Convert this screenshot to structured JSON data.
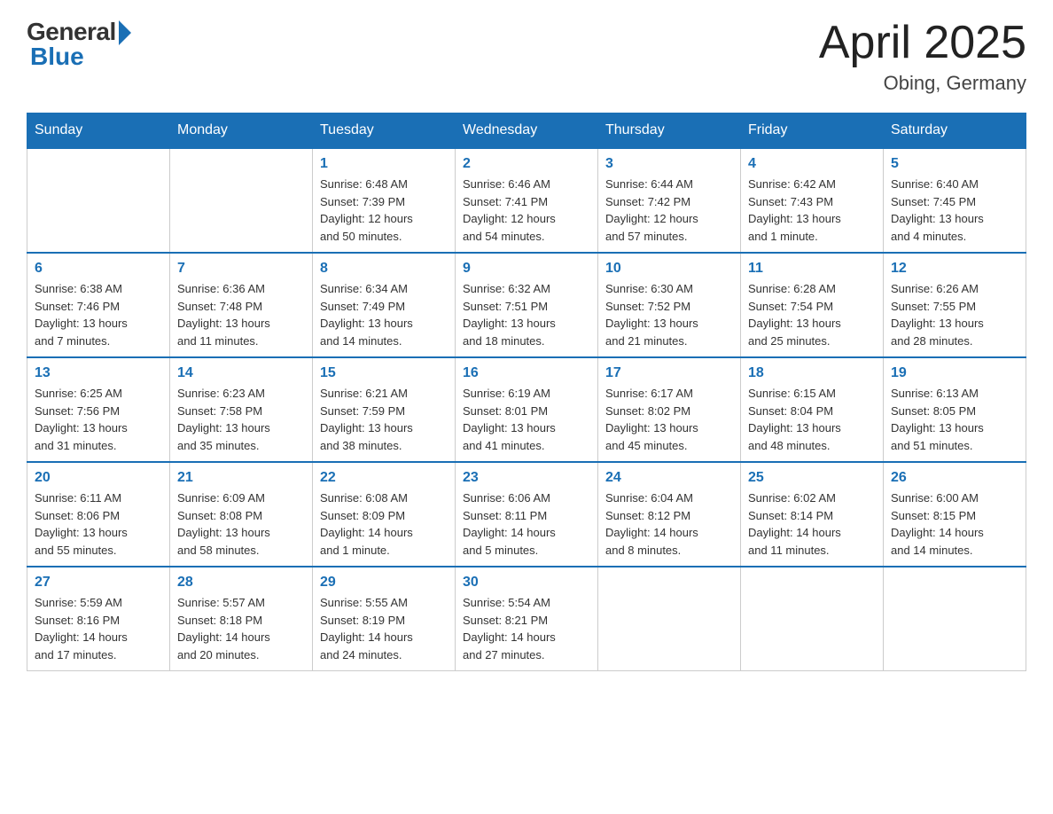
{
  "logo": {
    "general": "General",
    "blue": "Blue"
  },
  "title": {
    "month": "April 2025",
    "location": "Obing, Germany"
  },
  "weekdays": [
    "Sunday",
    "Monday",
    "Tuesday",
    "Wednesday",
    "Thursday",
    "Friday",
    "Saturday"
  ],
  "weeks": [
    [
      {
        "day": "",
        "info": ""
      },
      {
        "day": "",
        "info": ""
      },
      {
        "day": "1",
        "info": "Sunrise: 6:48 AM\nSunset: 7:39 PM\nDaylight: 12 hours\nand 50 minutes."
      },
      {
        "day": "2",
        "info": "Sunrise: 6:46 AM\nSunset: 7:41 PM\nDaylight: 12 hours\nand 54 minutes."
      },
      {
        "day": "3",
        "info": "Sunrise: 6:44 AM\nSunset: 7:42 PM\nDaylight: 12 hours\nand 57 minutes."
      },
      {
        "day": "4",
        "info": "Sunrise: 6:42 AM\nSunset: 7:43 PM\nDaylight: 13 hours\nand 1 minute."
      },
      {
        "day": "5",
        "info": "Sunrise: 6:40 AM\nSunset: 7:45 PM\nDaylight: 13 hours\nand 4 minutes."
      }
    ],
    [
      {
        "day": "6",
        "info": "Sunrise: 6:38 AM\nSunset: 7:46 PM\nDaylight: 13 hours\nand 7 minutes."
      },
      {
        "day": "7",
        "info": "Sunrise: 6:36 AM\nSunset: 7:48 PM\nDaylight: 13 hours\nand 11 minutes."
      },
      {
        "day": "8",
        "info": "Sunrise: 6:34 AM\nSunset: 7:49 PM\nDaylight: 13 hours\nand 14 minutes."
      },
      {
        "day": "9",
        "info": "Sunrise: 6:32 AM\nSunset: 7:51 PM\nDaylight: 13 hours\nand 18 minutes."
      },
      {
        "day": "10",
        "info": "Sunrise: 6:30 AM\nSunset: 7:52 PM\nDaylight: 13 hours\nand 21 minutes."
      },
      {
        "day": "11",
        "info": "Sunrise: 6:28 AM\nSunset: 7:54 PM\nDaylight: 13 hours\nand 25 minutes."
      },
      {
        "day": "12",
        "info": "Sunrise: 6:26 AM\nSunset: 7:55 PM\nDaylight: 13 hours\nand 28 minutes."
      }
    ],
    [
      {
        "day": "13",
        "info": "Sunrise: 6:25 AM\nSunset: 7:56 PM\nDaylight: 13 hours\nand 31 minutes."
      },
      {
        "day": "14",
        "info": "Sunrise: 6:23 AM\nSunset: 7:58 PM\nDaylight: 13 hours\nand 35 minutes."
      },
      {
        "day": "15",
        "info": "Sunrise: 6:21 AM\nSunset: 7:59 PM\nDaylight: 13 hours\nand 38 minutes."
      },
      {
        "day": "16",
        "info": "Sunrise: 6:19 AM\nSunset: 8:01 PM\nDaylight: 13 hours\nand 41 minutes."
      },
      {
        "day": "17",
        "info": "Sunrise: 6:17 AM\nSunset: 8:02 PM\nDaylight: 13 hours\nand 45 minutes."
      },
      {
        "day": "18",
        "info": "Sunrise: 6:15 AM\nSunset: 8:04 PM\nDaylight: 13 hours\nand 48 minutes."
      },
      {
        "day": "19",
        "info": "Sunrise: 6:13 AM\nSunset: 8:05 PM\nDaylight: 13 hours\nand 51 minutes."
      }
    ],
    [
      {
        "day": "20",
        "info": "Sunrise: 6:11 AM\nSunset: 8:06 PM\nDaylight: 13 hours\nand 55 minutes."
      },
      {
        "day": "21",
        "info": "Sunrise: 6:09 AM\nSunset: 8:08 PM\nDaylight: 13 hours\nand 58 minutes."
      },
      {
        "day": "22",
        "info": "Sunrise: 6:08 AM\nSunset: 8:09 PM\nDaylight: 14 hours\nand 1 minute."
      },
      {
        "day": "23",
        "info": "Sunrise: 6:06 AM\nSunset: 8:11 PM\nDaylight: 14 hours\nand 5 minutes."
      },
      {
        "day": "24",
        "info": "Sunrise: 6:04 AM\nSunset: 8:12 PM\nDaylight: 14 hours\nand 8 minutes."
      },
      {
        "day": "25",
        "info": "Sunrise: 6:02 AM\nSunset: 8:14 PM\nDaylight: 14 hours\nand 11 minutes."
      },
      {
        "day": "26",
        "info": "Sunrise: 6:00 AM\nSunset: 8:15 PM\nDaylight: 14 hours\nand 14 minutes."
      }
    ],
    [
      {
        "day": "27",
        "info": "Sunrise: 5:59 AM\nSunset: 8:16 PM\nDaylight: 14 hours\nand 17 minutes."
      },
      {
        "day": "28",
        "info": "Sunrise: 5:57 AM\nSunset: 8:18 PM\nDaylight: 14 hours\nand 20 minutes."
      },
      {
        "day": "29",
        "info": "Sunrise: 5:55 AM\nSunset: 8:19 PM\nDaylight: 14 hours\nand 24 minutes."
      },
      {
        "day": "30",
        "info": "Sunrise: 5:54 AM\nSunset: 8:21 PM\nDaylight: 14 hours\nand 27 minutes."
      },
      {
        "day": "",
        "info": ""
      },
      {
        "day": "",
        "info": ""
      },
      {
        "day": "",
        "info": ""
      }
    ]
  ]
}
